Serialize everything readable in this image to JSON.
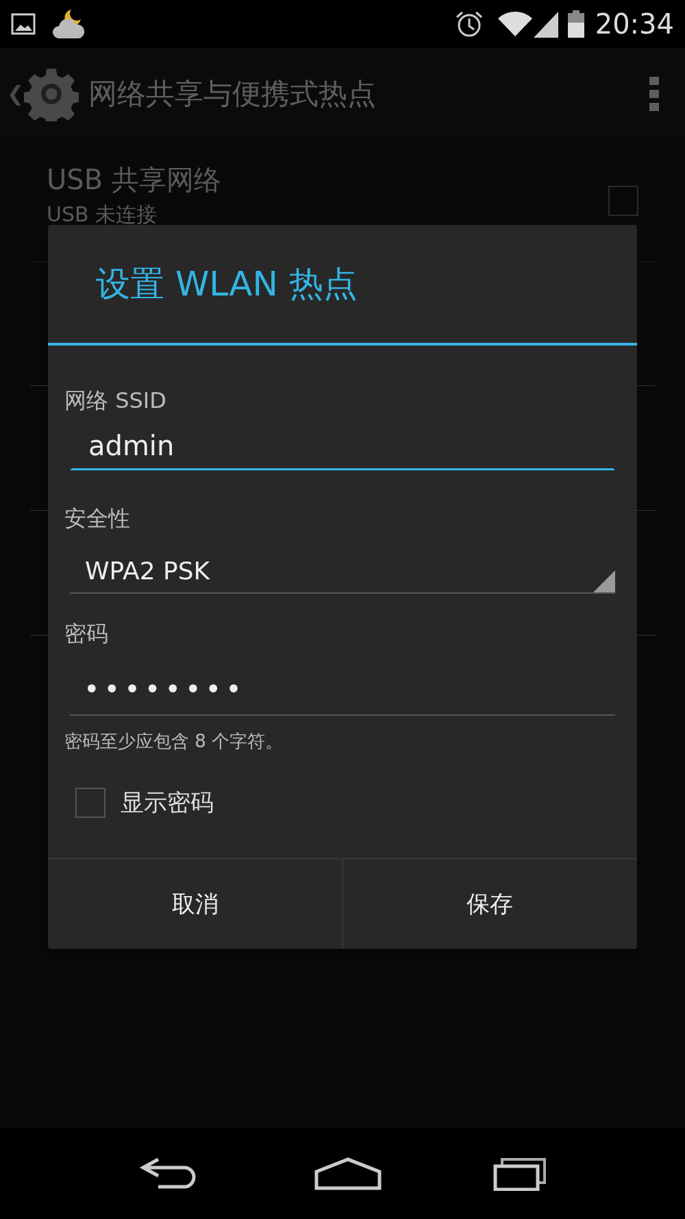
{
  "status_bar": {
    "time": "20:34"
  },
  "action_bar": {
    "back": "❮",
    "title": "网络共享与便携式热点"
  },
  "settings": [
    {
      "title": "USB 共享网络",
      "subtitle": "USB 未连接",
      "checked": false
    }
  ],
  "dialog": {
    "title": "设置 WLAN 热点",
    "ssid": {
      "label": "网络 SSID",
      "value": "admin",
      "focused": true
    },
    "security": {
      "label": "安全性",
      "value": "WPA2 PSK"
    },
    "password": {
      "label": "密码",
      "value": "••••••••",
      "hint": "密码至少应包含 8 个字符。"
    },
    "show_password": {
      "label": "显示密码",
      "checked": false
    },
    "buttons": [
      "取消",
      "保存"
    ]
  }
}
